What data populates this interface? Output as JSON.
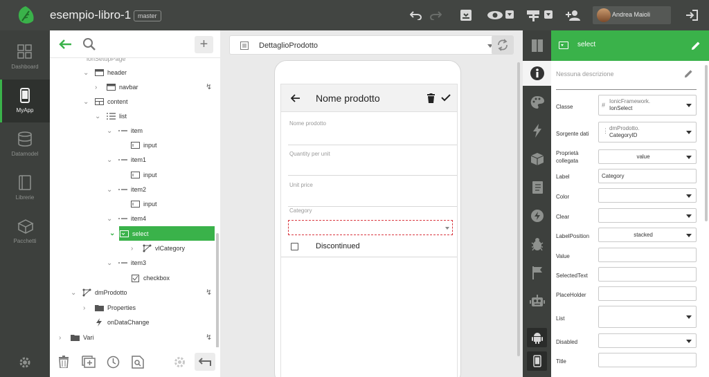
{
  "app": {
    "title": "esempio-libro-1",
    "branch": "master",
    "user_name": "Andrea Maioli"
  },
  "leftnav": [
    {
      "label": "Dashboard",
      "icon": "dashboard-icon"
    },
    {
      "label": "MyApp",
      "icon": "phone-icon",
      "active": true
    },
    {
      "label": "Datamodel",
      "icon": "database-icon"
    },
    {
      "label": "Librerie",
      "icon": "book-icon"
    },
    {
      "label": "Pacchetti",
      "icon": "packages-icon"
    }
  ],
  "tree": {
    "partial_top": "ionSetupPage",
    "nodes": [
      {
        "label": "header"
      },
      {
        "label": "navbar"
      },
      {
        "label": "content"
      },
      {
        "label": "list"
      },
      {
        "label": "item"
      },
      {
        "label": "input"
      },
      {
        "label": "item1"
      },
      {
        "label": "input"
      },
      {
        "label": "item2"
      },
      {
        "label": "input"
      },
      {
        "label": "item4"
      },
      {
        "label": "select"
      },
      {
        "label": "vlCategory"
      },
      {
        "label": "item3"
      },
      {
        "label": "checkbox"
      },
      {
        "label": "dmProdotto"
      },
      {
        "label": "Properties"
      },
      {
        "label": "onDataChange"
      },
      {
        "label": "Vari"
      }
    ]
  },
  "designer": {
    "page_name": "DettaglioProdotto",
    "header_title": "Nome prodotto",
    "fields": [
      {
        "label": "Nome prodotto"
      },
      {
        "label": "Quantity per unit"
      },
      {
        "label": "Unit price"
      },
      {
        "label": "Category"
      }
    ],
    "checkbox_label": "Discontinued"
  },
  "props": {
    "title": "select",
    "description_placeholder": "Nessuna descrizione",
    "rows": [
      {
        "label": "Classe",
        "line1": "IonicFramework.",
        "line2": "IonSelect"
      },
      {
        "label": "Sorgente dati",
        "line1": "dmProdotto.",
        "line2": "CategoryID"
      },
      {
        "label": "Proprietà collegata",
        "value": "value"
      },
      {
        "label": "Label",
        "value": "Category"
      },
      {
        "label": "Color",
        "value": ""
      },
      {
        "label": "Clear",
        "value": ""
      },
      {
        "label": "LabelPosition",
        "value": "stacked"
      },
      {
        "label": "Value",
        "value": ""
      },
      {
        "label": "SelectedText",
        "value": ""
      },
      {
        "label": "PlaceHolder",
        "value": ""
      },
      {
        "label": "List",
        "value": ""
      },
      {
        "label": "Disabled",
        "value": ""
      },
      {
        "label": "Title",
        "value": ""
      }
    ]
  },
  "colors": {
    "accent": "#3ab24a",
    "topbar": "#424542",
    "sidebar": "#3d403d",
    "danger": "#d9363e"
  }
}
